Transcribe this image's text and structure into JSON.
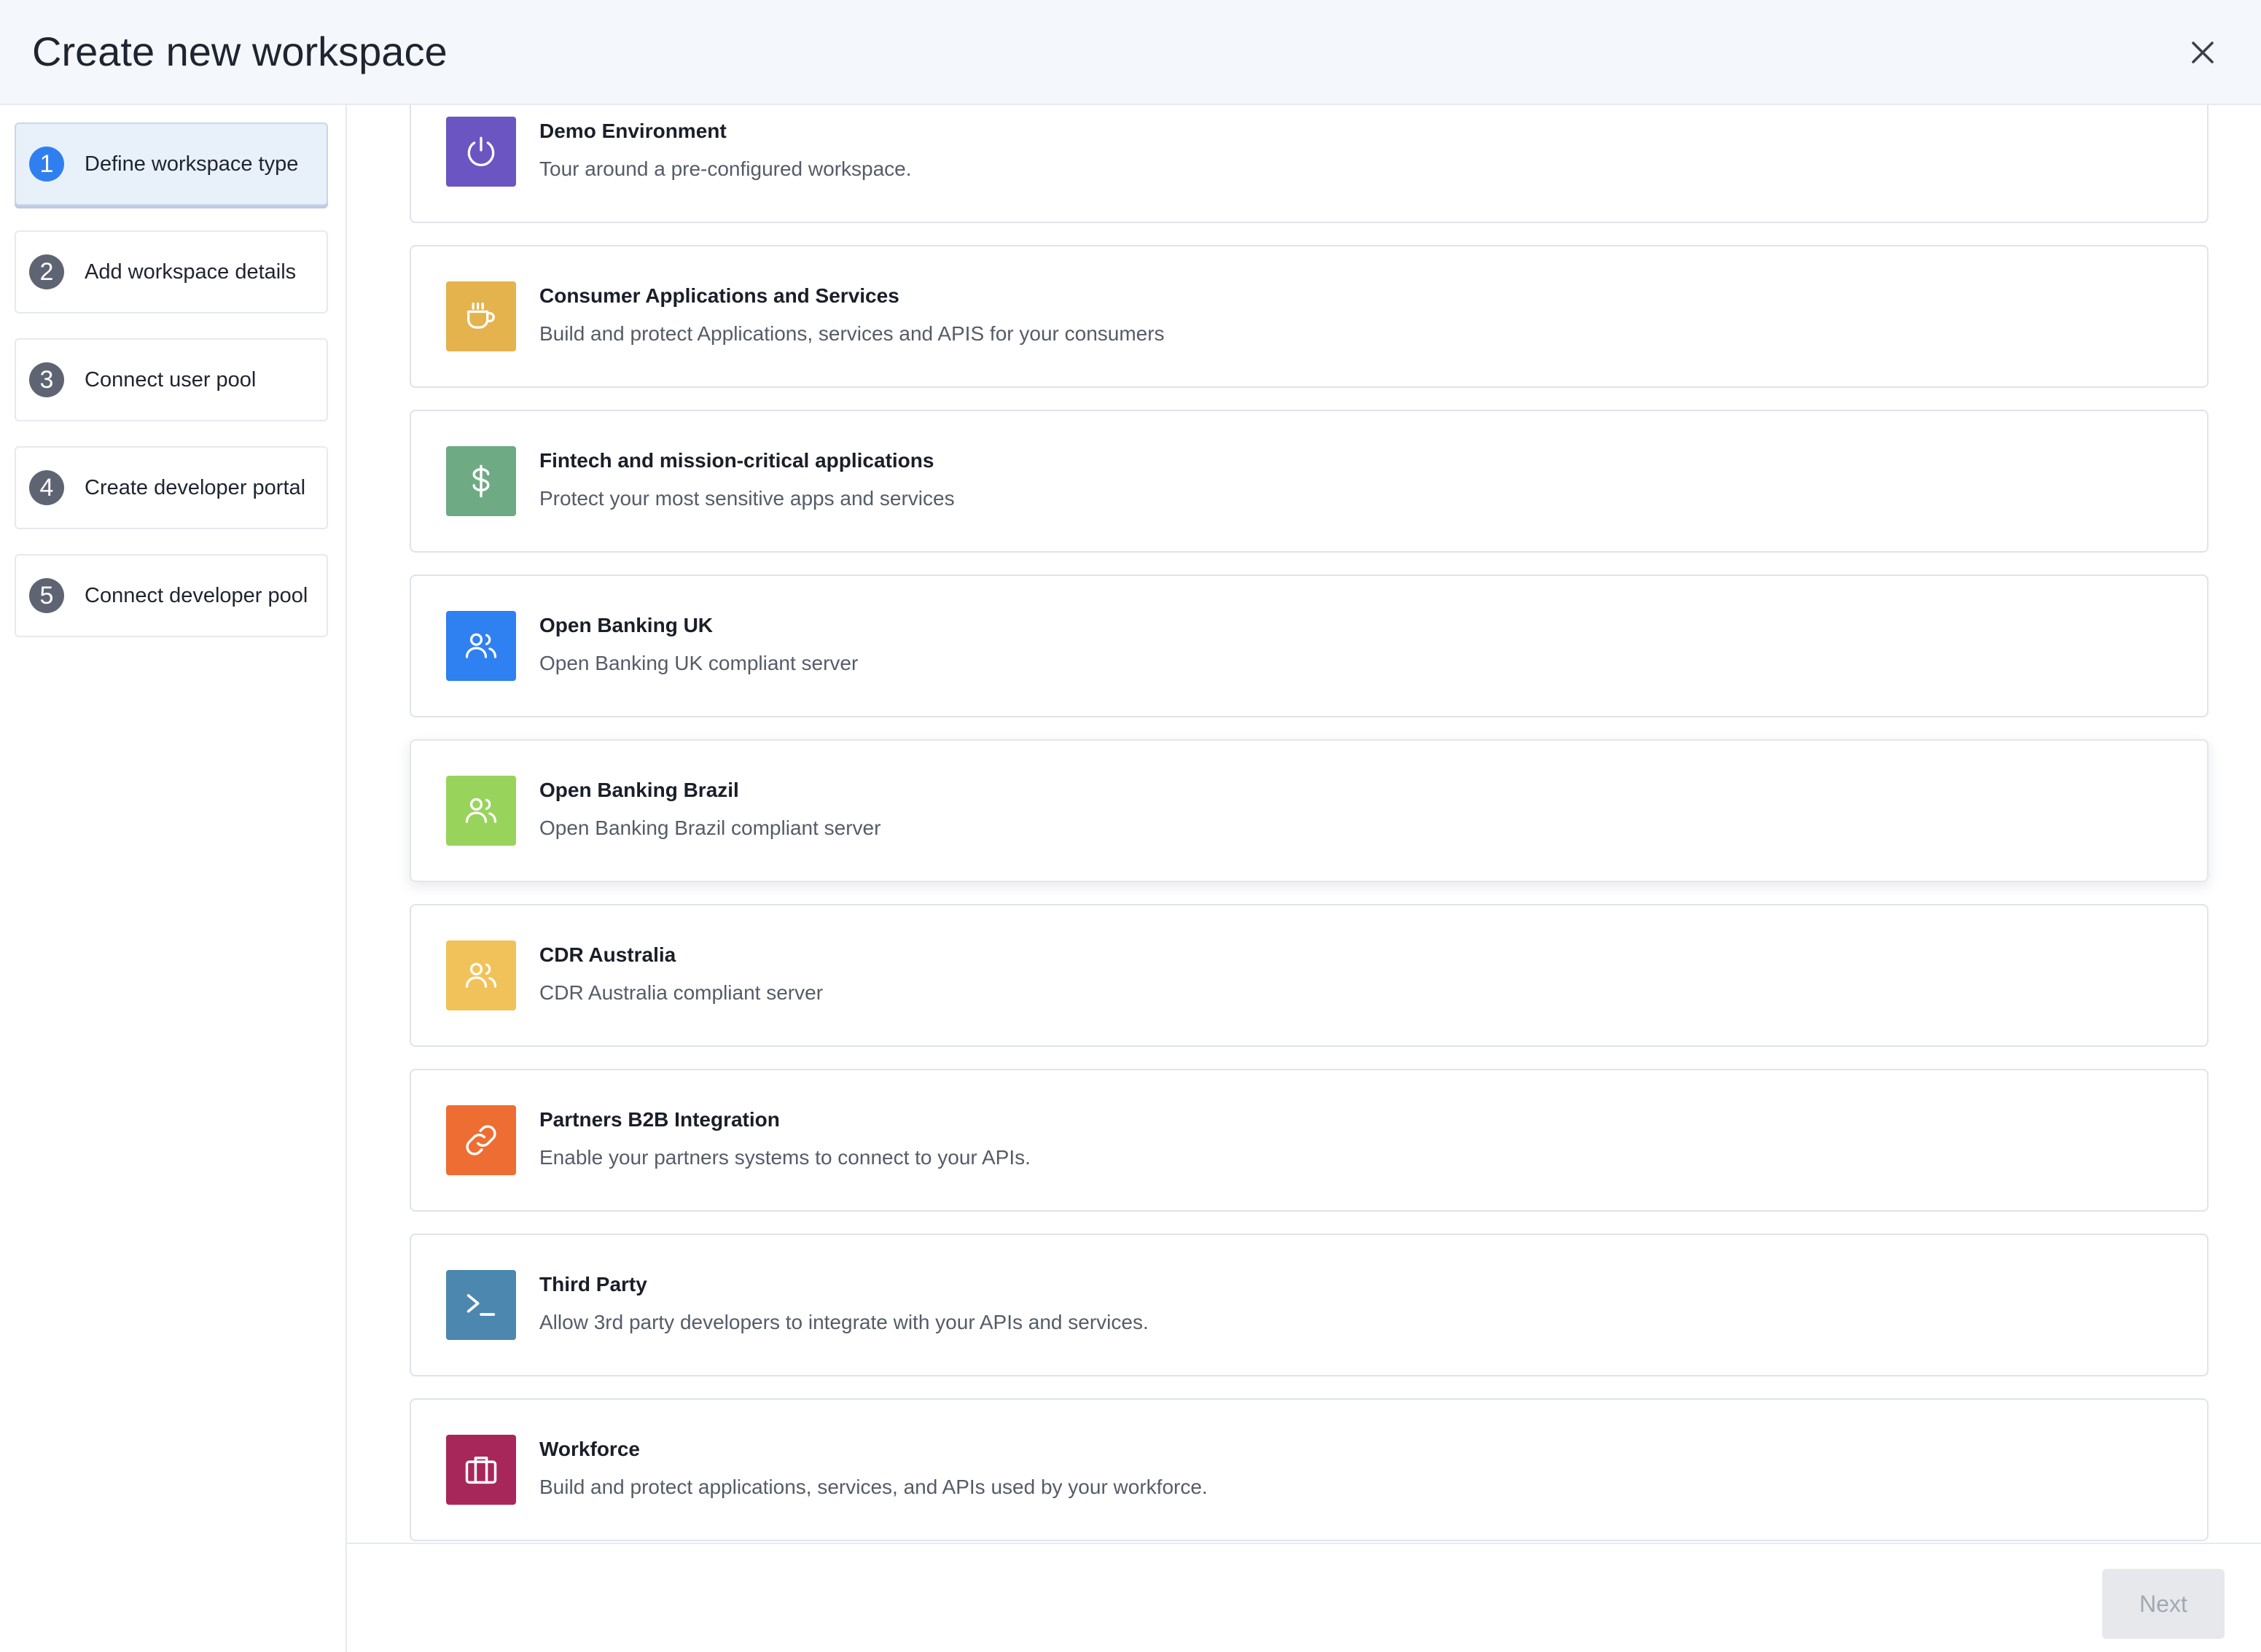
{
  "dialog": {
    "title": "Create new workspace"
  },
  "steps": [
    {
      "num": "1",
      "label": "Define workspace type",
      "active": true
    },
    {
      "num": "2",
      "label": "Add workspace details"
    },
    {
      "num": "3",
      "label": "Connect user pool"
    },
    {
      "num": "4",
      "label": "Create developer portal"
    },
    {
      "num": "5",
      "label": "Connect developer pool"
    }
  ],
  "workspace_types": [
    {
      "title": "Demo Environment",
      "description": "Tour around a pre-configured workspace.",
      "icon": "power-icon",
      "color": "#6a55c2"
    },
    {
      "title": "Consumer Applications and Services",
      "description": "Build and protect Applications, services and APIS for your consumers",
      "icon": "coffee-cup-icon",
      "color": "#e4b34e"
    },
    {
      "title": "Fintech and mission-critical applications",
      "description": "Protect your most sensitive apps and services",
      "icon": "dollar-icon",
      "color": "#6eaa84"
    },
    {
      "title": "Open Banking UK",
      "description": "Open Banking UK compliant server",
      "icon": "users-icon",
      "color": "#2f80f0"
    },
    {
      "title": "Open Banking Brazil",
      "description": "Open Banking Brazil compliant server",
      "icon": "users-icon",
      "color": "#98d45c"
    },
    {
      "title": "CDR Australia",
      "description": "CDR Australia compliant server",
      "icon": "users-icon",
      "color": "#f2c25a"
    },
    {
      "title": "Partners B2B Integration",
      "description": "Enable your partners systems to connect to your APIs.",
      "icon": "link-icon",
      "color": "#ee6d32"
    },
    {
      "title": "Third Party",
      "description": "Allow 3rd party developers to integrate with your APIs and services.",
      "icon": "terminal-icon",
      "color": "#4c87b0"
    },
    {
      "title": "Workforce",
      "description": "Build and protect applications, services, and APIs used by your workforce.",
      "icon": "briefcase-icon",
      "color": "#a8275a"
    }
  ],
  "footer": {
    "next_label": "Next"
  }
}
